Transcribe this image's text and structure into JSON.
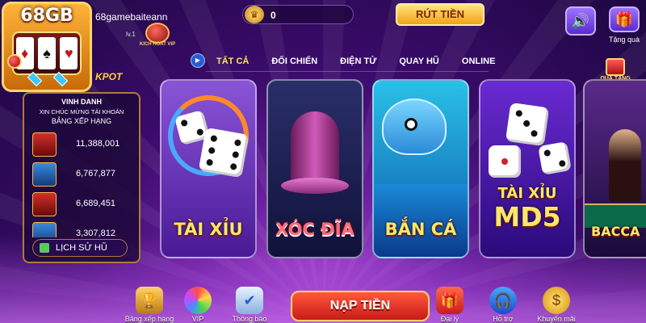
{
  "brand": {
    "logo_text": "68GB"
  },
  "user": {
    "name": "68gamebaiteann",
    "level": "lv.1",
    "vip_badge_text": "KICH HOAT VIP"
  },
  "wallet": {
    "balance": "0"
  },
  "header": {
    "withdraw_label": "RÚT TIỀN",
    "gift_label": "Tặng quà"
  },
  "icons": {
    "sound": "speaker-icon",
    "gift": "gift-box-icon",
    "play": "play-icon",
    "crown": "crown-icon",
    "history": "history-icon",
    "ranking": "trophy-icon",
    "vip": "vip-wheel-icon",
    "notice": "notification-icon",
    "agency": "gift-box-icon",
    "support": "headset-icon",
    "promo": "dollar-coin-icon"
  },
  "tabs": [
    {
      "label": "TẤT CẢ",
      "active": true
    },
    {
      "label": "ĐỐI CHIẾN",
      "active": false
    },
    {
      "label": "ĐIỆN TỬ",
      "active": false
    },
    {
      "label": "QUAY HŨ",
      "active": false
    },
    {
      "label": "ONLINE",
      "active": false
    }
  ],
  "bonus": {
    "label": "QUÀ TẶNG"
  },
  "ranking_panel": {
    "jackpot_label": "KPOT",
    "title": "VINH DANH",
    "subtitle": "XIN CHÚC MỪNG TÀI KHOẢN",
    "subtitle2": "BẢNG XẾP HẠNG",
    "rows": [
      {
        "value": "11,388,001"
      },
      {
        "value": "6,767,877"
      },
      {
        "value": "6,689,451"
      },
      {
        "value": "3,307,812"
      }
    ],
    "history_label": "LỊCH SỬ HŨ"
  },
  "games": [
    {
      "label": "TÀI XỈU"
    },
    {
      "label": "XÓC ĐĨA"
    },
    {
      "label": "BẮN CÁ"
    },
    {
      "label": "TÀI XỈU",
      "sub": "MD5"
    },
    {
      "label": "BACCA"
    }
  ],
  "bottom_nav": {
    "ranking": "Bảng xếp hạng",
    "vip": "VIP",
    "notice": "Thông báo",
    "deposit": "NẠP TIỀN",
    "agency": "Đại lý",
    "support": "Hỗ trợ",
    "promo": "Khuyến mãi"
  },
  "colors": {
    "accent_gold": "#ffe36a",
    "deposit_red": "#e0282a",
    "panel_bg": "#1c0838"
  }
}
